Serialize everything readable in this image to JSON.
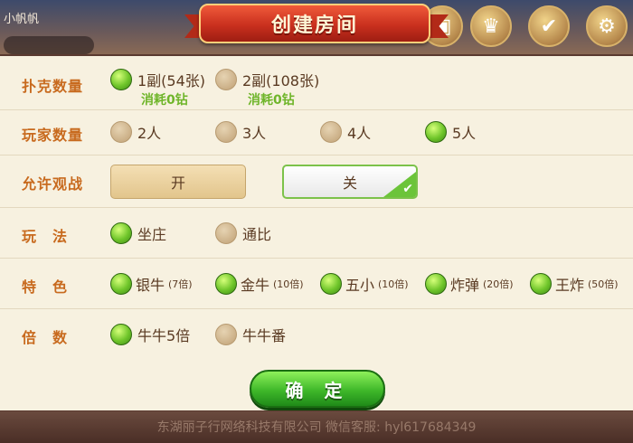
{
  "header": {
    "player_name": "小帆帆",
    "title": "创建房间"
  },
  "footer": {
    "text": "东湖丽子行网络科技有限公司 微信客服: hyl617684349"
  },
  "rows": {
    "cards": {
      "label": "扑克数量",
      "options": [
        {
          "label": "1副(54张)",
          "sub": "消耗0钻",
          "selected": true
        },
        {
          "label": "2副(108张)",
          "sub": "消耗0钻",
          "selected": false
        }
      ]
    },
    "players": {
      "label": "玩家数量",
      "options": [
        {
          "label": "2人",
          "selected": false
        },
        {
          "label": "3人",
          "selected": false
        },
        {
          "label": "4人",
          "selected": false
        },
        {
          "label": "5人",
          "selected": true
        }
      ]
    },
    "spectate": {
      "label": "允许观战",
      "on_label": "开",
      "off_label": "关",
      "value": "off"
    },
    "mode": {
      "label": "玩　法",
      "options": [
        {
          "label": "坐庄",
          "selected": true
        },
        {
          "label": "通比",
          "selected": false
        }
      ]
    },
    "features": {
      "label": "特　色",
      "options": [
        {
          "label": "银牛",
          "note": "(7倍)",
          "selected": true
        },
        {
          "label": "金牛",
          "note": "(10倍)",
          "selected": true
        },
        {
          "label": "五小",
          "note": "(10倍)",
          "selected": true
        },
        {
          "label": "炸弹",
          "note": "(20倍)",
          "selected": true
        },
        {
          "label": "王炸",
          "note": "(50倍)",
          "selected": true
        }
      ]
    },
    "multiplier": {
      "label": "倍　数",
      "options": [
        {
          "label": "牛牛5倍",
          "selected": true
        },
        {
          "label": "牛牛番",
          "selected": false
        }
      ]
    }
  },
  "confirm_label": "确 定",
  "colors": {
    "accent_green": "#6fc52a",
    "label_orange": "#c86a1e",
    "panel_bg": "#f7f1e0",
    "banner_red": "#c9301e"
  }
}
